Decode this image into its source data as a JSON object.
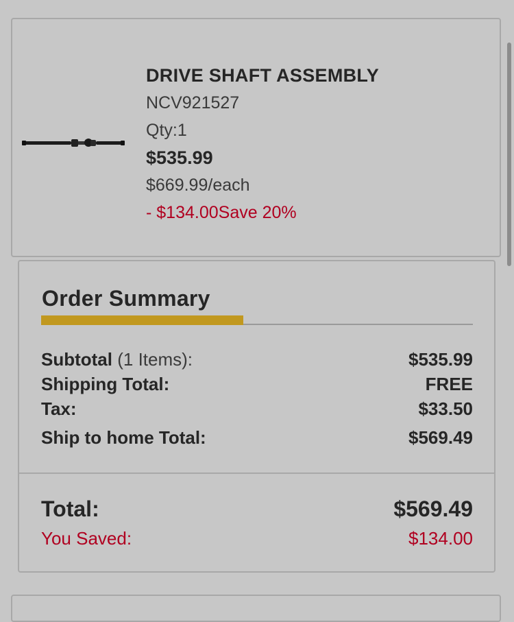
{
  "product": {
    "name": "DRIVE SHAFT ASSEMBLY",
    "part_number": "NCV921527",
    "qty": "Qty:1",
    "price": "$535.99",
    "each_price": "$669.99/each",
    "savings": "- $134.00Save 20%",
    "image_icon": "drive-shaft-image"
  },
  "summary": {
    "title": "Order Summary",
    "subtotal_label": "Subtotal",
    "subtotal_items": " (1 Items):",
    "subtotal_value": "$535.99",
    "shipping_label": "Shipping Total:",
    "shipping_value": "FREE",
    "tax_label": "Tax:",
    "tax_value": "$33.50",
    "ship_home_label": "Ship to home Total:",
    "ship_home_value": "$569.49",
    "total_label": "Total:",
    "total_value": "$569.49",
    "saved_label": "You Saved:",
    "saved_value": "$134.00"
  },
  "colors": {
    "background": "#c7c7c7",
    "accent": "#c1981f",
    "savings_red": "#b00020"
  }
}
